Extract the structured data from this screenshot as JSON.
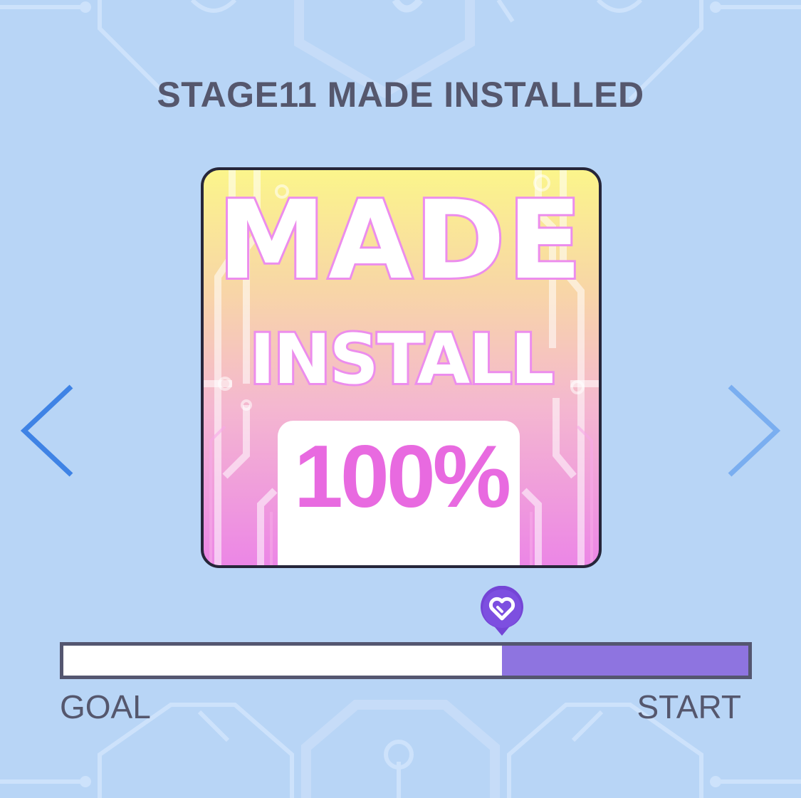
{
  "stage": {
    "title": "STAGE11 MADE INSTALLED"
  },
  "card": {
    "line1": "MADE",
    "line2": "INSTALL",
    "percent": "100%"
  },
  "progress": {
    "goal_label": "GOAL",
    "start_label": "START",
    "fraction_from_start": 0.36,
    "marker_icon": "heart-pin-icon"
  },
  "navigation": {
    "prev_icon": "chevron-left-icon",
    "next_icon": "chevron-right-icon"
  },
  "colors": {
    "background": "#b8d5f6",
    "title_text": "#55576d",
    "progress_fill": "#8e74e0",
    "marker": "#7445d6",
    "card_pink": "#e86ae0",
    "card_yellow": "#fbf58b",
    "arrow_left": "#3f83e5",
    "arrow_right": "#7aaef0"
  }
}
